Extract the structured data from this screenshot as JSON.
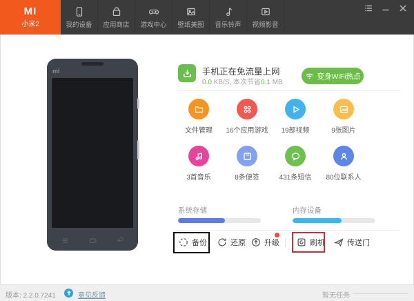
{
  "header": {
    "logo_text": "MI",
    "device_name": "小米2",
    "tabs": [
      {
        "label": "我的设备",
        "icon": "phone-icon"
      },
      {
        "label": "应用商店",
        "icon": "shopping-bag-icon"
      },
      {
        "label": "游戏中心",
        "icon": "gamepad-icon"
      },
      {
        "label": "壁纸美图",
        "icon": "picture-icon"
      },
      {
        "label": "音乐铃声",
        "icon": "music-note-icon"
      },
      {
        "label": "视频影音",
        "icon": "video-icon"
      }
    ],
    "window_controls": {
      "menu": "list-icon",
      "minimize": "minimize-icon",
      "close": "close-icon"
    }
  },
  "phone": {
    "brand_label": "mi"
  },
  "status": {
    "title": "手机正在免流量上网",
    "speed_value": "0.0",
    "speed_tail": " KB/S, 本次节省",
    "save_value": "0.1",
    "save_tail": " MB",
    "wifi_button": "变身WiFi热点"
  },
  "features": [
    {
      "label": "文件管理",
      "color": "#f7931e",
      "icon": "folder-icon"
    },
    {
      "label": "16个应用游戏",
      "color": "#f05a50",
      "icon": "apps-icon"
    },
    {
      "label": "19部视频",
      "color": "#41b2ea",
      "icon": "play-icon"
    },
    {
      "label": "9张图片",
      "color": "#f9bd4d",
      "icon": "image-icon"
    },
    {
      "label": "3首音乐",
      "color": "#e8439b",
      "icon": "music-icon"
    },
    {
      "label": "8条便签",
      "color": "#81a2f3",
      "icon": "note-icon"
    },
    {
      "label": "431条短信",
      "color": "#6dc14f",
      "icon": "message-icon"
    },
    {
      "label": "80位联系人",
      "color": "#5b87e9",
      "icon": "contact-icon"
    }
  ],
  "storage": {
    "items": [
      {
        "label": "系统存储",
        "percent": 57,
        "color": "#5b7ce2"
      },
      {
        "label": "内存设备",
        "percent": 59,
        "color": "#3fb5ea"
      }
    ]
  },
  "actions": {
    "backup": "备份",
    "restore": "还原",
    "upgrade": "升级",
    "flash": "刷机",
    "portal": "传送门"
  },
  "footer": {
    "version": "版本: 2.2.0.7241",
    "feedback": "意见反馈",
    "task_status": "暂无任务"
  },
  "colors": {
    "brand_orange": "#f2591d",
    "toolbar_dark": "#3b3b3b",
    "green": "#6abf4b",
    "wifi_green": "#6cbd45",
    "bar_system": "#5b7ce2",
    "bar_memory": "#3fb5ea",
    "badge_red": "#f04b4b",
    "highlight_black": "#0d0d0d",
    "highlight_red": "#c0333c",
    "update_blue": "#2ba3df"
  }
}
